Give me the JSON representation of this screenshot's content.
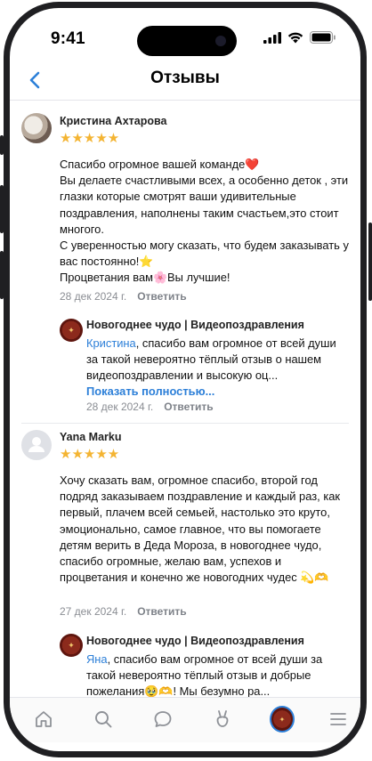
{
  "status_bar": {
    "time": "9:41"
  },
  "header": {
    "title": "Отзывы",
    "back_icon": "chevron-left-icon"
  },
  "reviews": [
    {
      "author": "Кристина Ахтарова",
      "rating": 5,
      "stars": "★★★★★",
      "text": "Спасибо огромное вашей команде❤️\nВы делаете счастливыми всех, а особенно деток , эти глазки которые смотрят ваши удивительные поздравления, наполнены таким счастьем,это стоит многого.\nС уверенностью могу сказать, что будем заказывать у вас постоянно!⭐\nПроцветания вам🌸Вы лучшие!",
      "date": "28 дек 2024 г.",
      "reply_label": "Ответить",
      "response": {
        "author": "Новогоднее чудо | Видеопоздравления",
        "mention": "Кристина",
        "text": ", спасибо вам огромное от всей души за такой невероятно тёплый отзыв о нашем видеопоздравлении и высокую оц...",
        "more": "Показать полностью...",
        "date": "28 дек 2024 г.",
        "reply_label": "Ответить"
      }
    },
    {
      "author": "Yana Marku",
      "rating": 5,
      "stars": "★★★★★",
      "text": "Хочу сказать вам, огромное спасибо, второй год подряд заказываем поздравление и каждый раз, как первый, плачем всей семьей, настолько это круто, эмоционально, самое главное, что вы помогаете детям верить в Деда Мороза, в новогоднее чудо, спасибо огромные, желаю вам, успехов и процветания и конечно же новогодних чудес 💫🫶",
      "date": "27 дек 2024 г.",
      "reply_label": "Ответить",
      "response": {
        "author": "Новогоднее чудо | Видеопоздравления",
        "mention": "Яна",
        "text": ", спасибо вам огромное от всей души за такой невероятно тёплый отзыв и добрые пожелания🥹🫶! Мы безумно ра..."
      }
    }
  ],
  "tab_bar": {
    "items": [
      "home-icon",
      "search-icon",
      "chat-icon",
      "clips-icon",
      "community-avatar",
      "menu-icon"
    ]
  },
  "colors": {
    "accent": "#2c7fd8",
    "star": "#f4b432",
    "muted": "#8a8d93"
  }
}
